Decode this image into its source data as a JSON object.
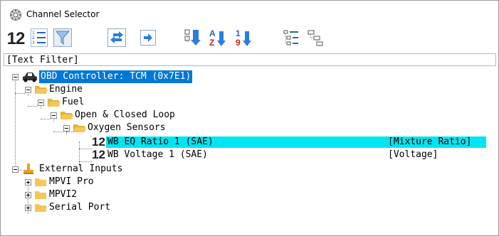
{
  "window": {
    "title": "Channel Selector"
  },
  "toolbar": {
    "buttons": [
      {
        "icon": "numeric-12-icon",
        "label": "12"
      },
      {
        "icon": "numbered-list-icon"
      },
      {
        "icon": "filter-flag-icon"
      },
      {
        "icon": "swap-arrows-icon"
      },
      {
        "icon": "arrow-right-icon"
      },
      {
        "icon": "expand-sort-icon"
      },
      {
        "icon": "sort-a-z-icon",
        "top": "A",
        "bottom": "Z"
      },
      {
        "icon": "sort-1-9-icon",
        "top": "1",
        "bottom": "9"
      },
      {
        "icon": "list-view-icon"
      },
      {
        "icon": "tree-view-icon"
      }
    ]
  },
  "filter": {
    "text": "[Text Filter]"
  },
  "tree": {
    "obd": "OBD Controller: TCM (0x7E1)",
    "engine": "Engine",
    "fuel": "Fuel",
    "loop": "Open & Closed Loop",
    "oxygen": "Oxygen Sensors",
    "channels": [
      {
        "prefix": "12",
        "label": "WB EQ Ratio 1 (SAE)",
        "unit": "[Mixture Ratio]",
        "highlighted": true
      },
      {
        "prefix": "12",
        "label": "WB Voltage 1 (SAE)",
        "unit": "[Voltage]",
        "highlighted": false
      }
    ],
    "external": "External Inputs",
    "inputs": [
      "MPVI Pro",
      "MPVI2",
      "Serial Port"
    ]
  },
  "colors": {
    "selection": "#0078d7",
    "highlight": "#00e5f2",
    "folder": "#f6c657"
  }
}
